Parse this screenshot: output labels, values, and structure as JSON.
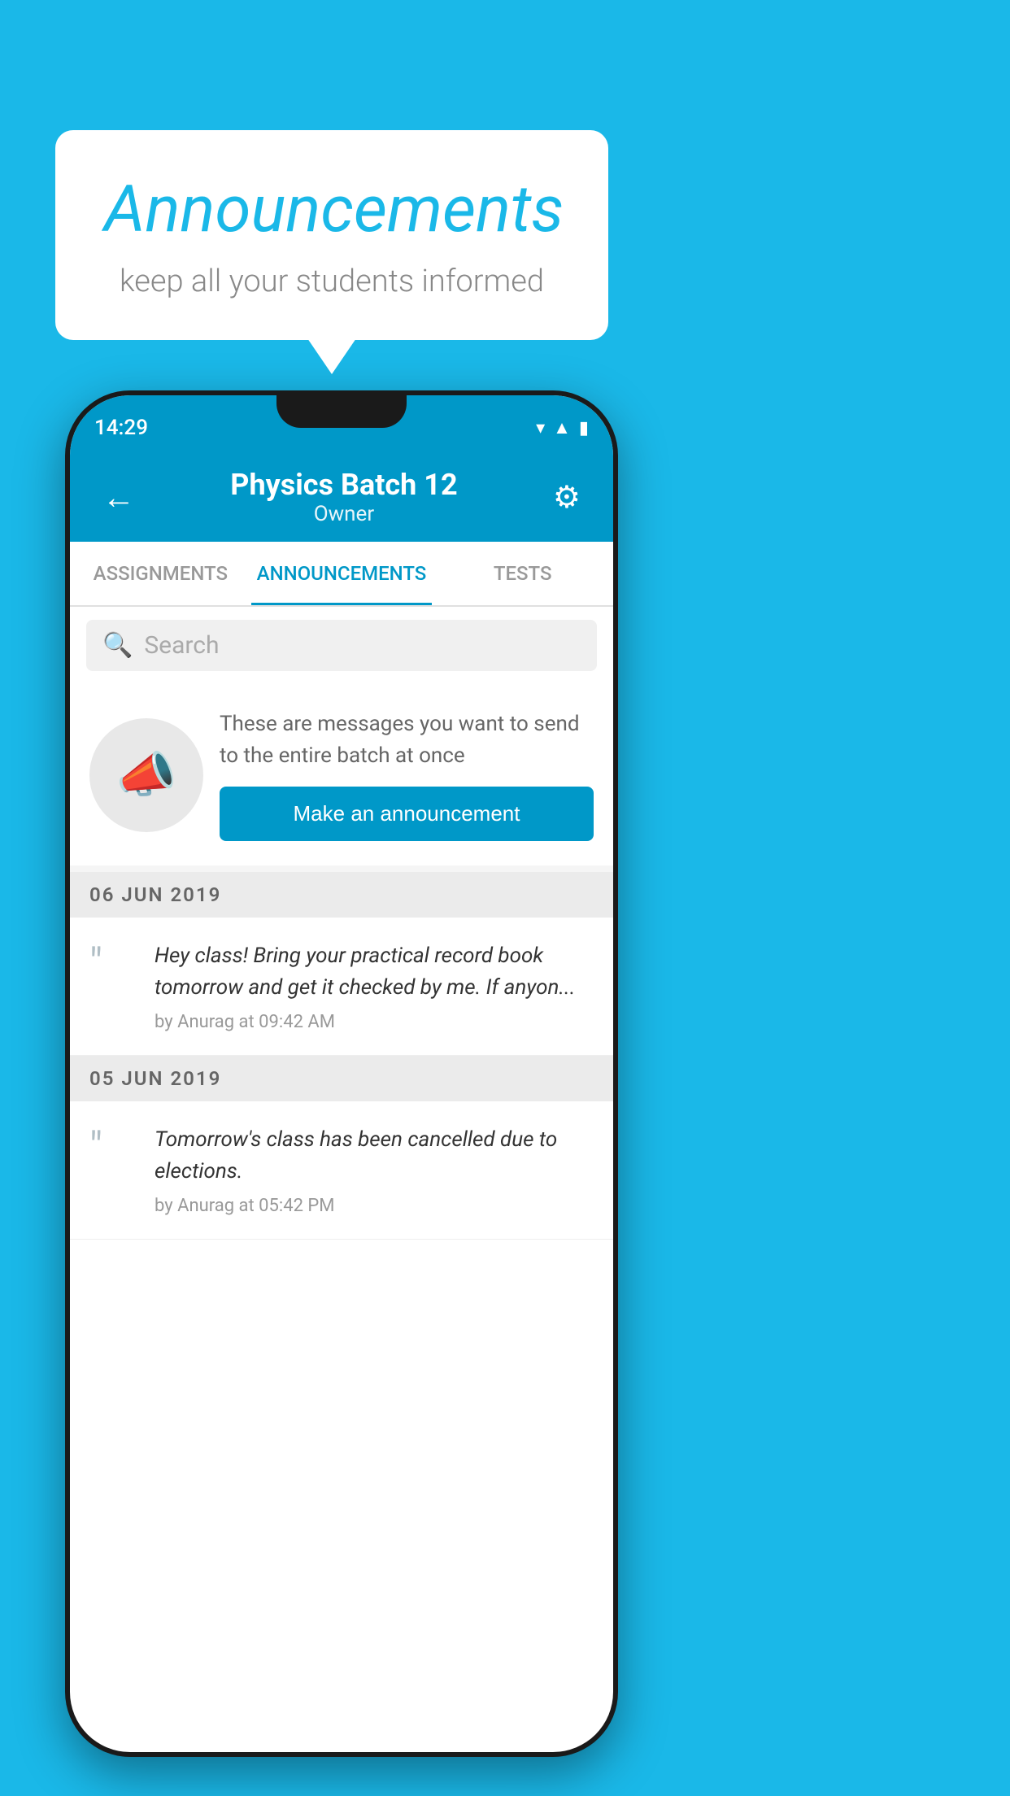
{
  "page": {
    "background_color": "#1ab8e8"
  },
  "speech_bubble": {
    "title": "Announcements",
    "subtitle": "keep all your students informed"
  },
  "phone": {
    "status_bar": {
      "time": "14:29"
    },
    "app_bar": {
      "title": "Physics Batch 12",
      "subtitle": "Owner",
      "back_label": "←",
      "settings_label": "⚙"
    },
    "tabs": [
      {
        "label": "ASSIGNMENTS",
        "active": false
      },
      {
        "label": "ANNOUNCEMENTS",
        "active": true
      },
      {
        "label": "TESTS",
        "active": false
      }
    ],
    "search": {
      "placeholder": "Search"
    },
    "promo": {
      "description": "These are messages you want to send to the entire batch at once",
      "button_label": "Make an announcement"
    },
    "announcements": [
      {
        "date": "06  JUN  2019",
        "message": "Hey class! Bring your practical record book tomorrow and get it checked by me. If anyon...",
        "meta": "by Anurag at 09:42 AM"
      },
      {
        "date": "05  JUN  2019",
        "message": "Tomorrow's class has been cancelled due to elections.",
        "meta": "by Anurag at 05:42 PM"
      }
    ]
  }
}
